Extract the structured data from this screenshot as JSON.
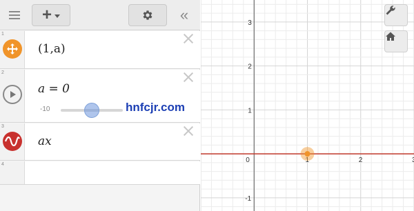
{
  "toolbar": {
    "menu_icon": "hamburger-icon",
    "add_icon": "plus-icon",
    "settings_icon": "gear-icon",
    "collapse_icon": "double-chevron-left-icon"
  },
  "expressions": [
    {
      "num": "1",
      "icon": "move-point-icon",
      "latex": "(1,a)"
    },
    {
      "num": "2",
      "icon": "play-icon",
      "latex": "a = 0",
      "slider": {
        "min_label": "-10",
        "min": -10,
        "max": 10,
        "value": 0
      }
    },
    {
      "num": "3",
      "icon": "sine-wave-icon",
      "latex": "ax"
    },
    {
      "num": "4"
    }
  ],
  "watermark": "hnfcjr.com",
  "graph": {
    "x_ticks": [
      "0",
      "1",
      "2",
      "3"
    ],
    "y_ticks": [
      "3",
      "2",
      "1",
      "-1"
    ],
    "xlim": [
      -1.0,
      3.0
    ],
    "ylim": [
      -1.3,
      3.5
    ],
    "point": {
      "x": 1,
      "y": 0
    },
    "line_slope": 0,
    "colors": {
      "line": "#c0392b",
      "point": "#f0942a",
      "axis": "#555555",
      "grid_minor": "#ececec",
      "grid_major": "#d4d4d4"
    },
    "tools": {
      "wrench_icon": "wrench-icon",
      "home_icon": "home-icon"
    }
  }
}
